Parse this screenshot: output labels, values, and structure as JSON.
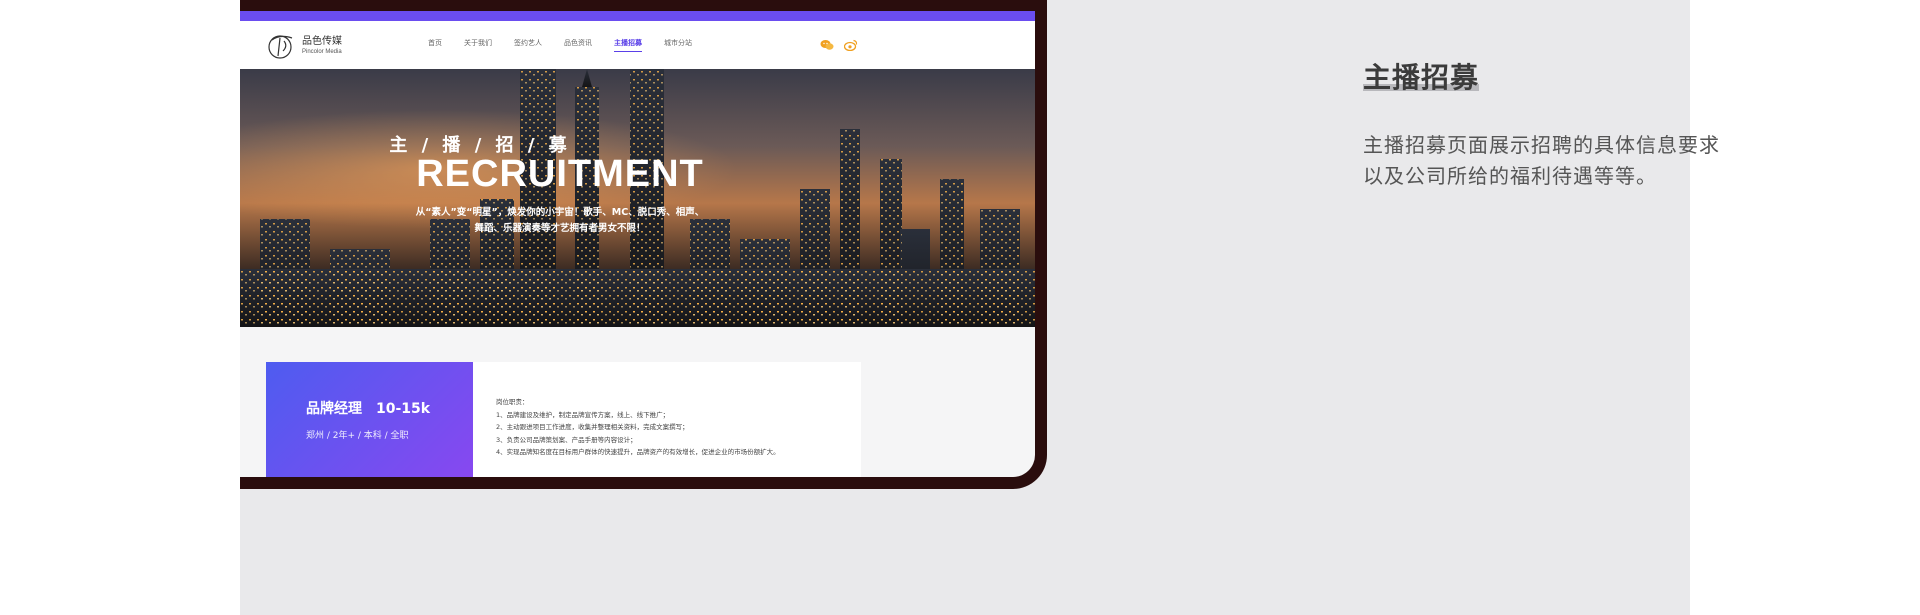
{
  "site": {
    "logo": {
      "cn": "品色传媒",
      "en": "Pincolor Media"
    },
    "nav": [
      {
        "label": "首页",
        "active": false
      },
      {
        "label": "关于我们",
        "active": false
      },
      {
        "label": "签约艺人",
        "active": false
      },
      {
        "label": "品色资讯",
        "active": false
      },
      {
        "label": "主播招募",
        "active": true
      },
      {
        "label": "城市分站",
        "active": false
      }
    ],
    "icons": [
      "wechat-icon",
      "weibo-icon"
    ],
    "accent_color": "#5a40e8"
  },
  "hero": {
    "title_cn": "主 / 播 / 招 / 募",
    "title_en": "RECRUITMENT",
    "subtitle_line1": "从“素人”变“明星”，焕发你的小宇宙！歌手、MC、脱口秀、相声、",
    "subtitle_line2": "舞蹈、乐器演奏等才艺拥有者男女不限！"
  },
  "job": {
    "title": "品牌经理",
    "salary": "10-15k",
    "meta": "郑州 / 2年+ / 本科 / 全职",
    "duties_heading": "岗位职责：",
    "duties": [
      "1、品牌建设及维护，制定品牌宣传方案，线上、线下推广；",
      "2、主动跟进项目工作进度，收集并整理相关资料，完成文案撰写；",
      "3、负责公司品牌策划案、产品手册等内容设计；",
      "4、实现品牌知名度在目标用户群体的快速提升，品牌资产的有效增长，促进企业的市场份额扩大。"
    ],
    "gradient": [
      "#4e5cf0",
      "#8a47f0"
    ]
  },
  "description": {
    "title": "主播招募",
    "body_line1": "主播招募页面展示招聘的具体信息要求",
    "body_line2": "以及公司所给的福利待遇等等。"
  }
}
